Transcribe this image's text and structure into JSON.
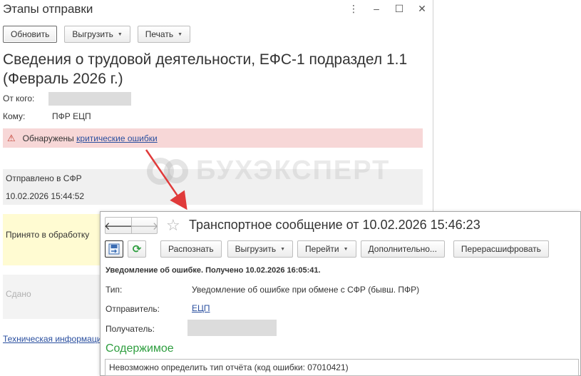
{
  "window1": {
    "title": "Этапы отправки",
    "controls": {
      "menu": "⋮",
      "minimize": "–",
      "maximize": "☐",
      "close": "✕"
    },
    "toolbar": {
      "refresh": "Обновить",
      "export": "Выгрузить",
      "print": "Печать"
    },
    "doc_title": "Сведения о трудовой деятельности, ЕФС-1 подраздел 1.1 (Февраль 2026 г.)",
    "from_label": "От кого:",
    "to_label": "Кому:",
    "to_value": "ПФР ЕЦП",
    "error": {
      "text": "Обнаружены",
      "link": "критические ошибки"
    },
    "stages": {
      "sent_label": "Отправлено в СФР",
      "sent_time": "10.02.2026 15:44:52",
      "accepted_label": "Принято в обработку",
      "done_label": "Сдано"
    },
    "tech_link": "Техническая информация"
  },
  "watermark": "БУХЭКСПЕРТ",
  "window2": {
    "nav": {
      "back": "🡐",
      "forward": "🡒"
    },
    "star": "☆",
    "title": "Транспортное сообщение от 10.02.2026 15:46:23",
    "toolbar": {
      "recognize": "Распознать",
      "export": "Выгрузить",
      "go": "Перейти",
      "more": "Дополнительно...",
      "decrypt": "Перерасшифровать"
    },
    "notice_header": "Уведомление об ошибке. Получено 10.02.2026 16:05:41.",
    "type_label": "Тип:",
    "type_value": "Уведомление об ошибке при обмене с СФР (бывш. ПФР)",
    "sender_label": "Отправитель:",
    "sender_value": "ЕЦП",
    "recipient_label": "Получатель:",
    "section_title": "Содержимое",
    "content_text": "Невозможно определить тип отчёта (код ошибки: 07010421)"
  },
  "colors": {
    "error_bg": "#f7d7d7",
    "accepted_bg": "#fffbd2",
    "link": "#2a4f9f",
    "green": "#2e9e3f",
    "arrow": "#e03a3a"
  },
  "icons": [
    "warning-icon",
    "refresh-icon",
    "back-arrow-icon",
    "forward-arrow-icon",
    "star-icon",
    "save-icon",
    "menu-icon"
  ]
}
